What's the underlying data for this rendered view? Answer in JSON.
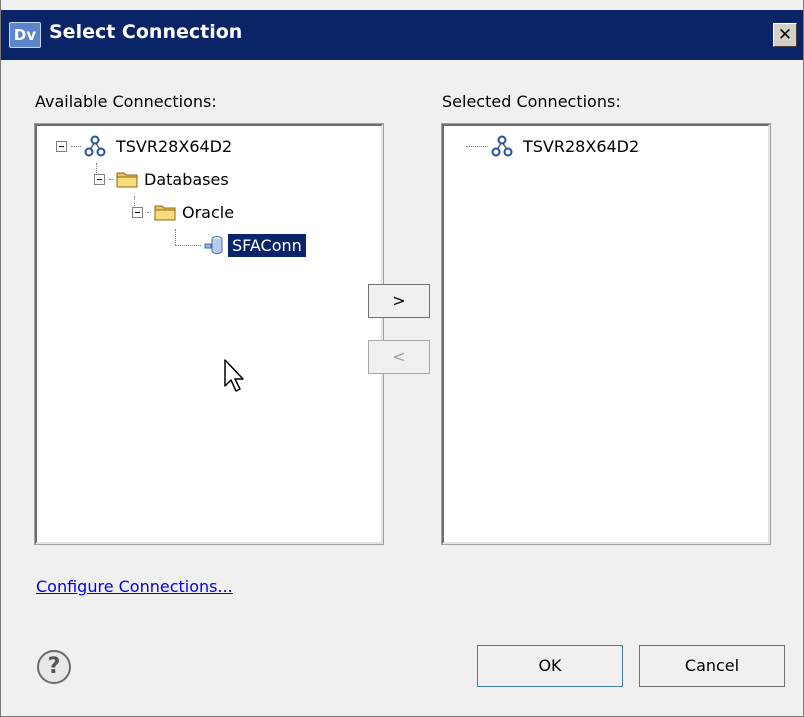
{
  "window": {
    "icon_text": "Dv",
    "title": "Select Connection",
    "close_glyph": "✕"
  },
  "available": {
    "label": "Available Connections:",
    "tree": [
      {
        "label": "TSVR28X64D2",
        "icon": "network-icon",
        "expanded": true
      },
      {
        "label": "Databases",
        "icon": "folder-icon",
        "expanded": true
      },
      {
        "label": "Oracle",
        "icon": "folder-icon",
        "expanded": true
      },
      {
        "label": "SFAConn",
        "icon": "database-icon",
        "selected": true
      }
    ]
  },
  "selected": {
    "label": "Selected Connections:",
    "tree": [
      {
        "label": "TSVR28X64D2",
        "icon": "network-icon"
      }
    ]
  },
  "buttons": {
    "add": ">",
    "remove": "<",
    "ok": "OK",
    "cancel": "Cancel"
  },
  "links": {
    "configure": "Configure Connections..."
  },
  "help": {
    "glyph": "?"
  },
  "colors": {
    "titlebar": "#0b2468",
    "selection": "#0a246a",
    "link": "#0000ee"
  }
}
